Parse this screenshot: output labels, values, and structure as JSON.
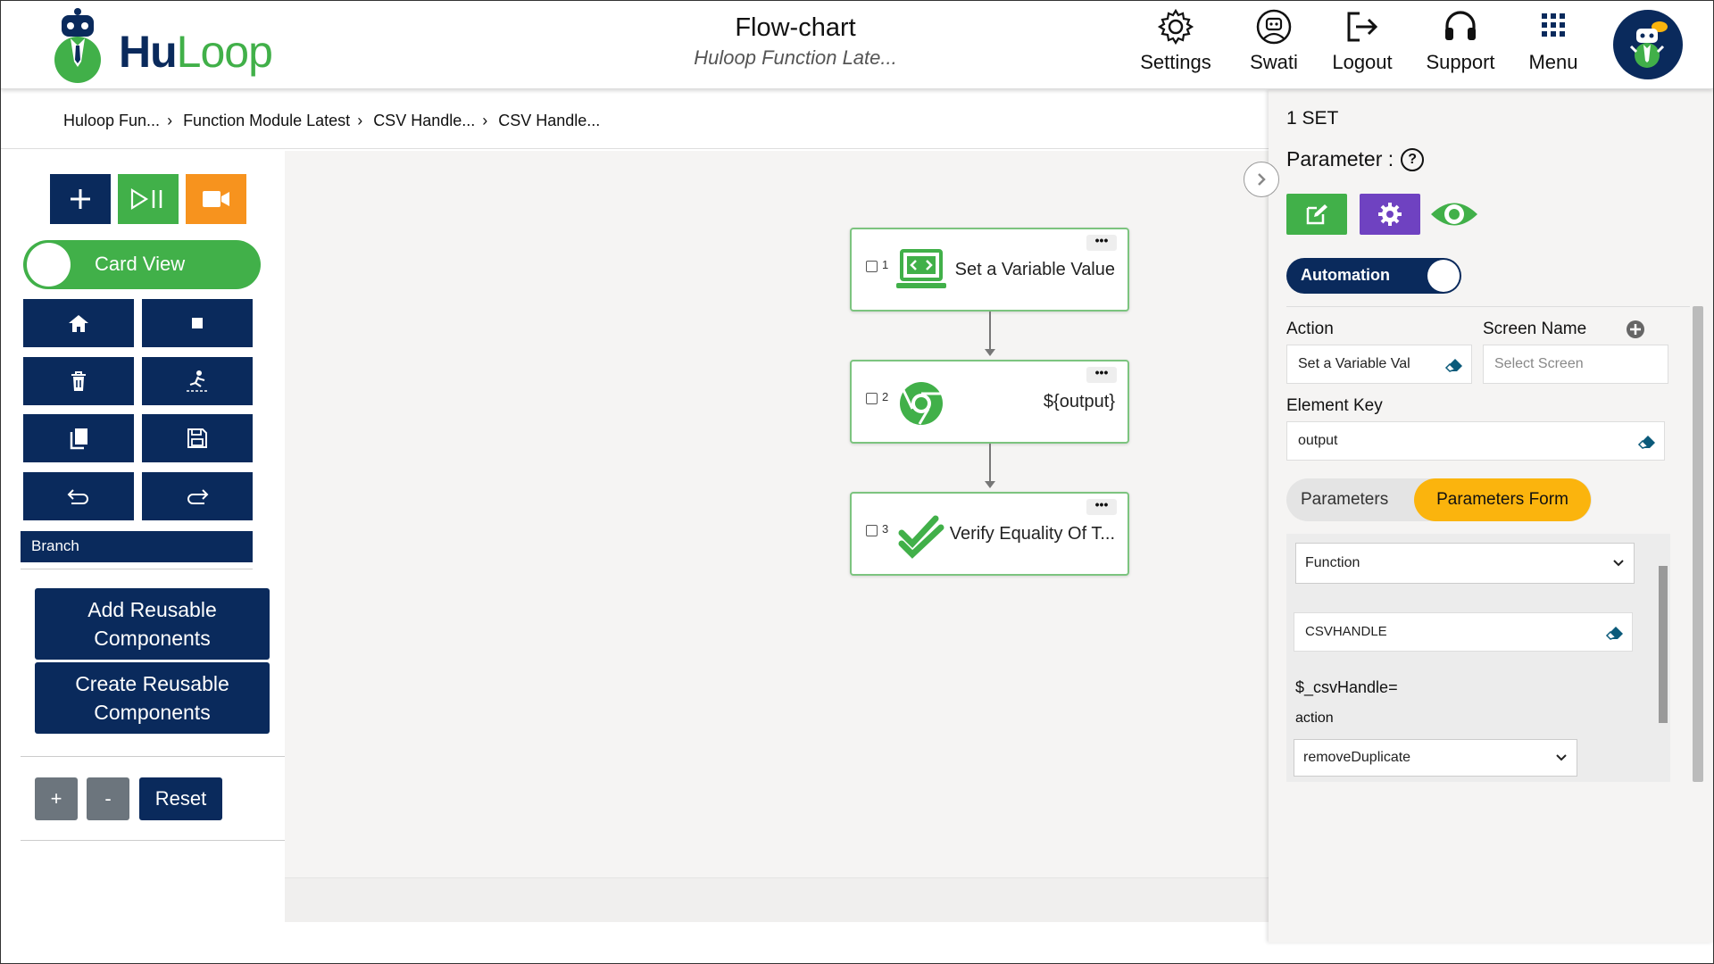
{
  "header": {
    "logo_brand_a": "Hu",
    "logo_brand_b": "Loop",
    "title": "Flow-chart",
    "subtitle": "Huloop Function Late...",
    "nav": [
      {
        "label": "Settings",
        "icon": "gear-icon"
      },
      {
        "label": "Swati",
        "icon": "user-robot-icon"
      },
      {
        "label": "Logout",
        "icon": "logout-icon"
      },
      {
        "label": "Support",
        "icon": "headset-icon"
      },
      {
        "label": "Menu",
        "icon": "grid-icon"
      }
    ]
  },
  "breadcrumb": [
    "Huloop Fun...",
    "Function Module Latest",
    "CSV Handle...",
    "CSV Handle..."
  ],
  "left_panel": {
    "toggle_label": "Card View",
    "branch_label": "Branch",
    "add_reusable": "Add Reusable Components",
    "create_reusable": "Create Reusable Components",
    "zoom_in": "+",
    "zoom_out": "-",
    "reset": "Reset"
  },
  "flow": {
    "nodes": [
      {
        "num": "1",
        "label": "Set a Variable Value",
        "icon": "monitor-code-icon"
      },
      {
        "num": "2",
        "label": "${output}",
        "icon": "chrome-icon"
      },
      {
        "num": "3",
        "label": "Verify Equality Of T...",
        "icon": "double-check-icon"
      }
    ],
    "menu_glyph": "•••"
  },
  "right_panel": {
    "set_label": "1 SET",
    "parameter_label": "Parameter :",
    "help_glyph": "?",
    "automation_label": "Automation",
    "action_label": "Action",
    "action_value": "Set a Variable Val",
    "screen_name_label": "Screen Name",
    "screen_placeholder": "Select Screen",
    "element_key_label": "Element Key",
    "element_key_value": "output",
    "tab_parameters": "Parameters",
    "tab_parameters_form": "Parameters Form",
    "function_select": "Function",
    "csv_value": "CSVHANDLE",
    "csv_var": "$_csvHandle=",
    "action_sub_label": "action",
    "action_select": "removeDuplicate"
  },
  "colors": {
    "navy": "#0a2a5c",
    "green": "#41b049",
    "orange": "#f7931e",
    "purple": "#6f42c1",
    "yellow": "#fbb40d"
  }
}
